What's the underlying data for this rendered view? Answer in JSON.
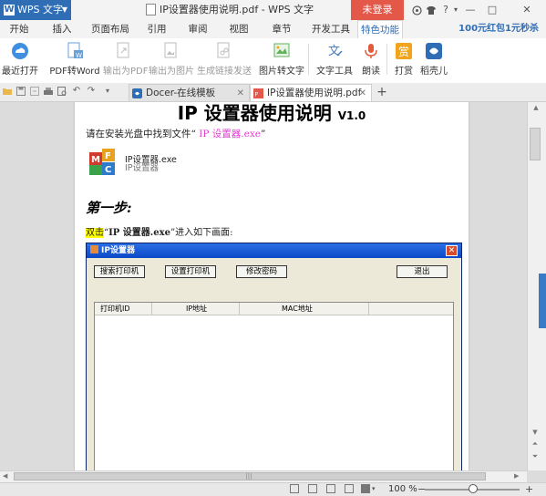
{
  "titlebar": {
    "app_name": "WPS 文字",
    "doc_title": "IP设置器使用说明.pdf - WPS 文字",
    "login_label": "未登录",
    "icons": [
      "skin-icon",
      "shirt-icon",
      "help-icon",
      "minimize-icon",
      "maximize-icon",
      "close-icon"
    ],
    "help_glyph": "?",
    "minimize_glyph": "—",
    "maximize_glyph": "□",
    "close_glyph": "✕"
  },
  "menu": {
    "tabs": [
      "开始",
      "插入",
      "页面布局",
      "引用",
      "审阅",
      "视图",
      "章节",
      "开发工具",
      "特色功能"
    ],
    "active": "特色功能",
    "promo": "100元红包1元秒杀"
  },
  "ribbon": {
    "buttons": [
      {
        "label": "最近打开",
        "icon": "cloud-icon",
        "color": "#3f8ee0",
        "disabled": false
      },
      {
        "label": "PDF转Word",
        "icon": "pdf-to-word-icon",
        "color": "#6aa0d8",
        "disabled": false
      },
      {
        "label": "输出为PDF",
        "icon": "export-pdf-icon",
        "color": "#bdbdbd",
        "disabled": true
      },
      {
        "label": "输出为图片",
        "icon": "export-image-icon",
        "color": "#bdbdbd",
        "disabled": true
      },
      {
        "label": "生成链接发送",
        "icon": "share-link-icon",
        "color": "#bdbdbd",
        "disabled": true
      },
      {
        "label": "图片转文字",
        "icon": "image-to-text-icon",
        "color": "#5fb35a",
        "disabled": false
      },
      {
        "label": "文字工具",
        "icon": "text-tool-icon",
        "color": "#4a7fc0",
        "disabled": false
      },
      {
        "label": "朗读",
        "icon": "microphone-icon",
        "color": "#e25a3a",
        "disabled": false
      },
      {
        "label": "打赏",
        "icon": "reward-icon",
        "color": "#f2a51c",
        "disabled": false
      },
      {
        "label": "稻壳儿",
        "icon": "docer-icon",
        "color": "#2f6db5",
        "disabled": false
      }
    ]
  },
  "doc_tabs": [
    {
      "label": "Docer-在线模板",
      "active": false
    },
    {
      "label": "IP设置器使用说明.pdf",
      "active": true
    }
  ],
  "new_tab": "+",
  "close_glyph": "✕",
  "document": {
    "heading": "IP 设置器使用说明",
    "version": "V1.0",
    "intro_prefix": "请在安装光盘中找到文件“",
    "intro_file": " IP 设置器.exe",
    "intro_suffix": "”",
    "app_icon_label": "IP设置器.exe",
    "app_icon_sublabel": "IP设置器",
    "step_heading": "第一步:",
    "step_highlight": "双击",
    "step_quote_open": "“",
    "step_app": "IP 设置器.exe",
    "step_rest": "”进入如下画面:"
  },
  "dialog": {
    "title": "IP设置器",
    "close_glyph": "✕",
    "buttons": [
      "搜索打印机",
      "设置打印机",
      "修改密码",
      "退出"
    ],
    "columns": [
      "打印机ID",
      "IP地址",
      "MAC地址"
    ]
  },
  "status": {
    "zoom": "100 %",
    "minus": "−",
    "plus": "+"
  }
}
